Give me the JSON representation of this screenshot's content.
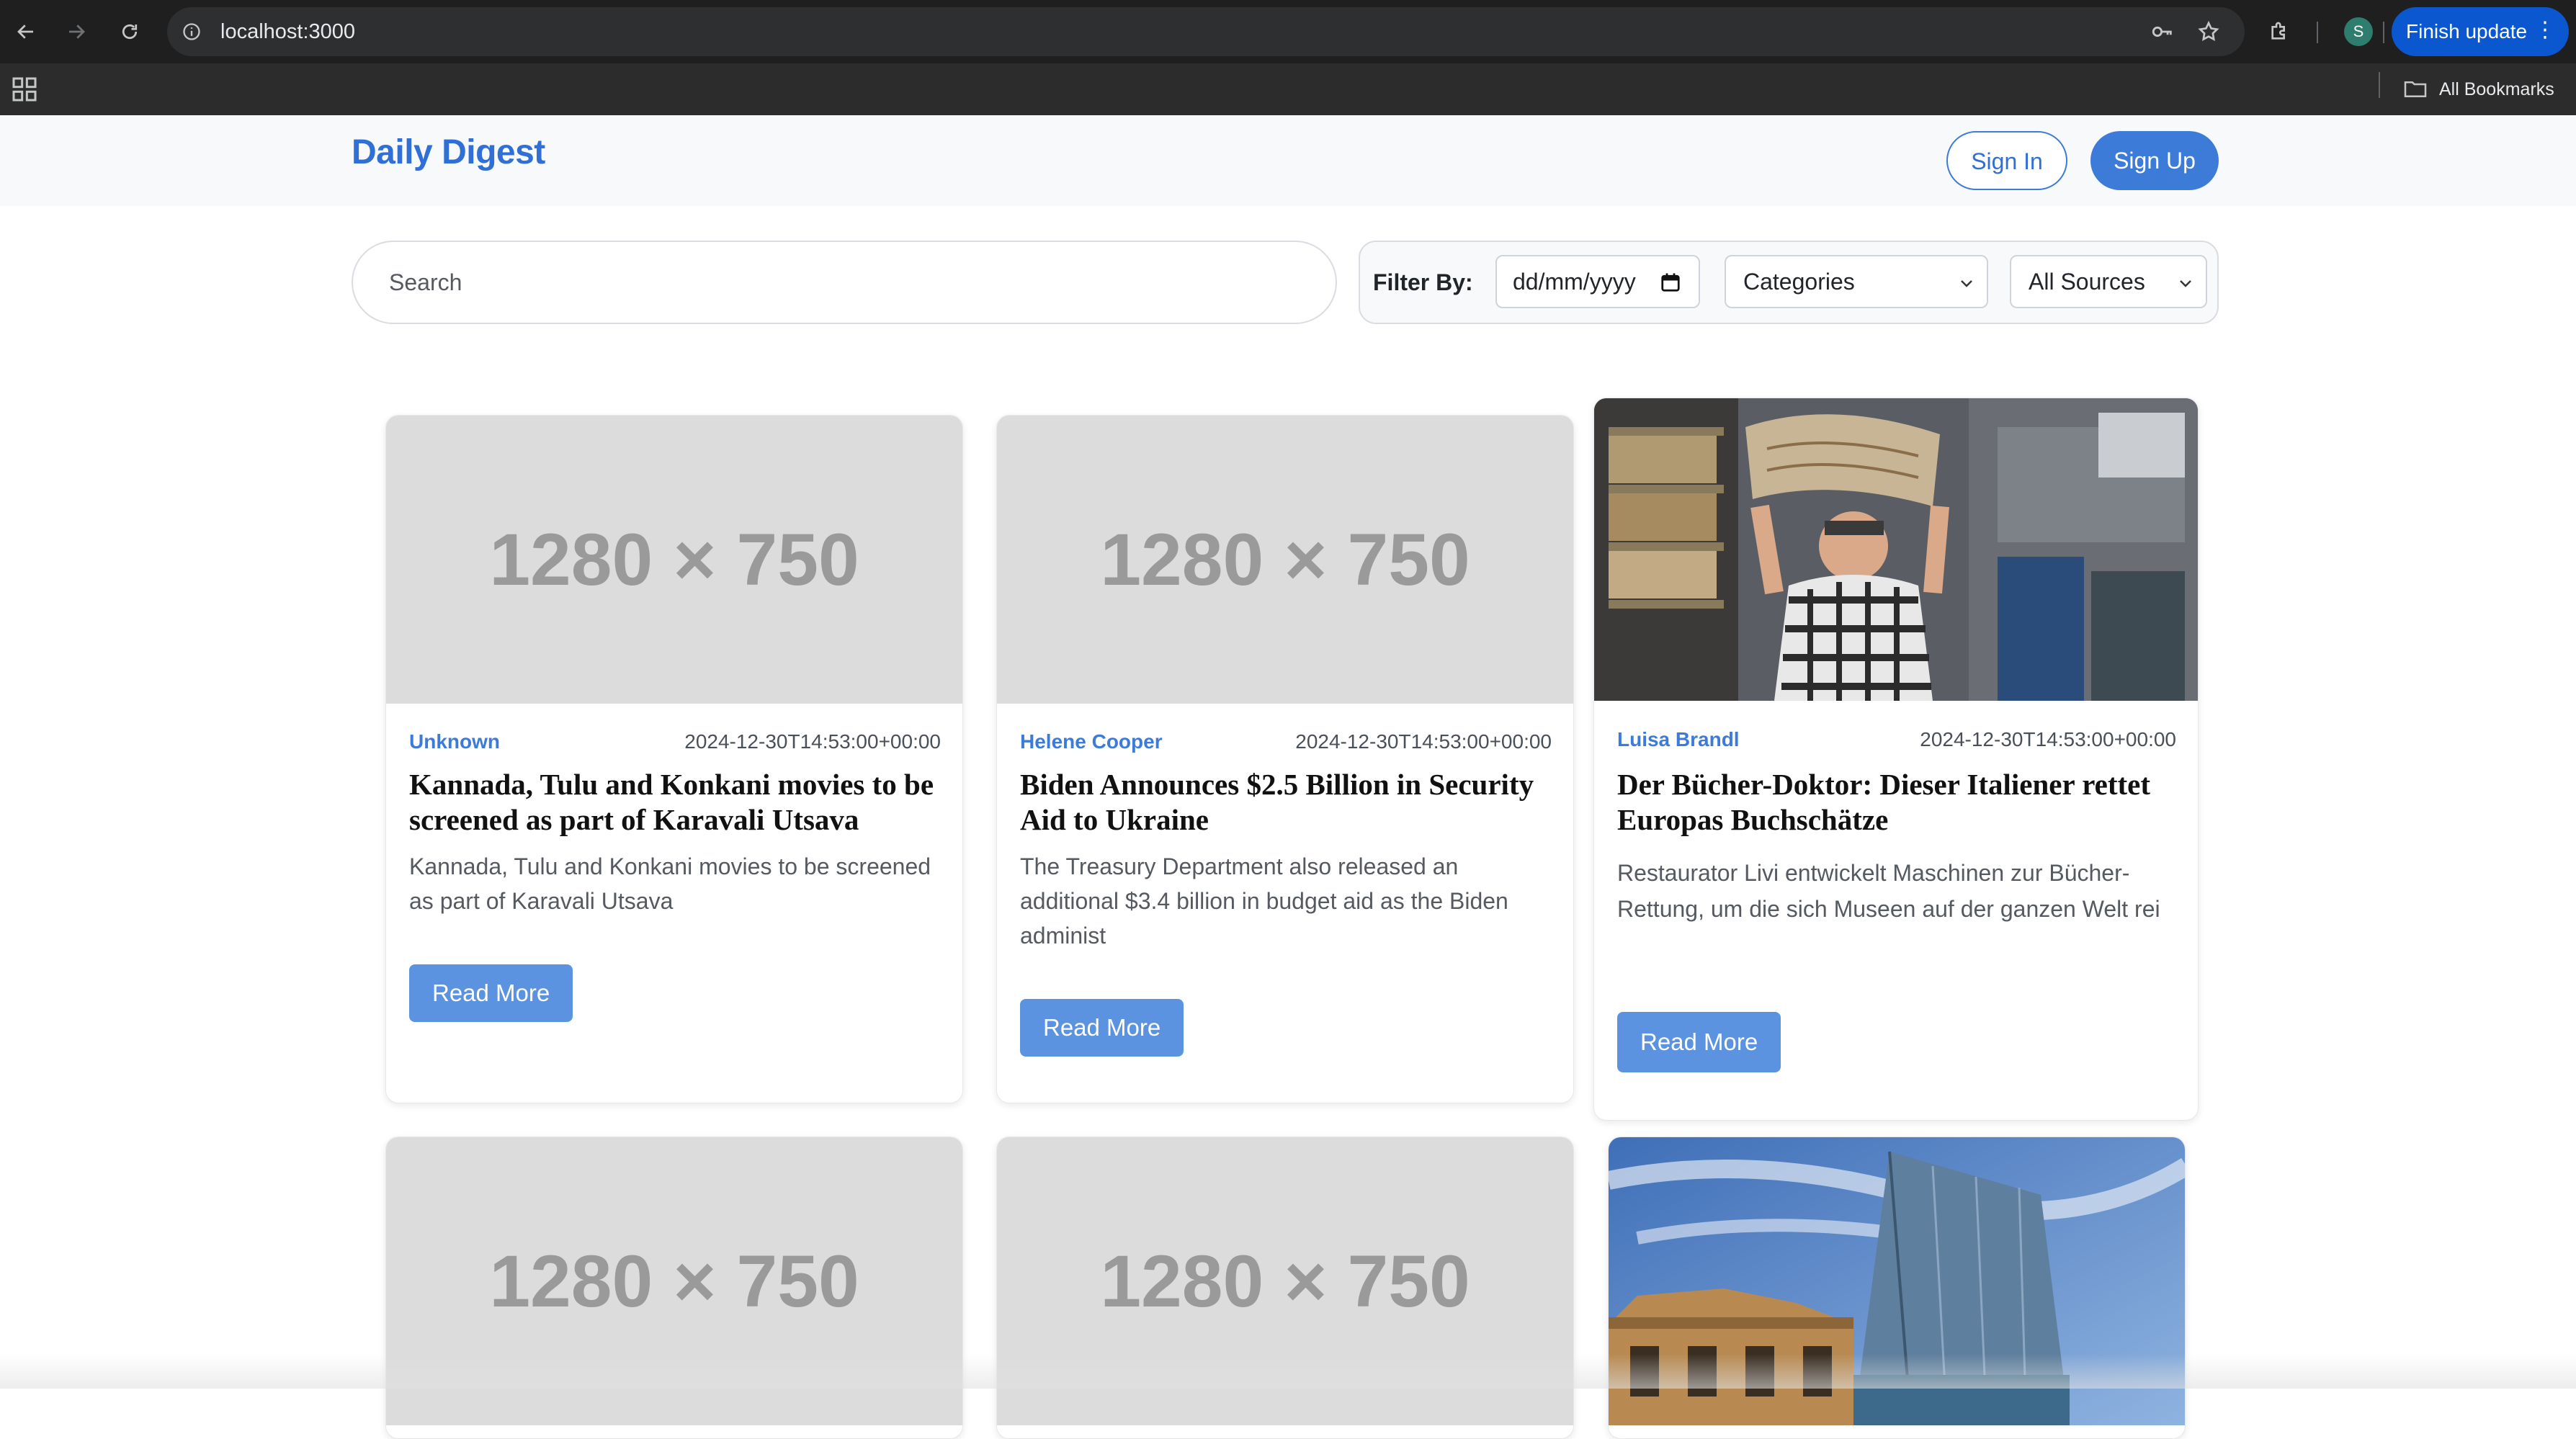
{
  "browser": {
    "url": "localhost:3000",
    "profile_initial": "S",
    "update_label": "Finish update",
    "bookmarks_label": "All Bookmarks"
  },
  "header": {
    "brand": "Daily Digest",
    "signin_label": "Sign In",
    "signup_label": "Sign Up"
  },
  "search": {
    "placeholder": "Search"
  },
  "filters": {
    "label": "Filter By:",
    "date_placeholder": "dd/mm/yyyy",
    "category_selected": "Categories",
    "source_selected": "All Sources"
  },
  "read_more_label": "Read More",
  "articles": [
    {
      "image_text": "1280 × 750",
      "author": "Unknown",
      "date": "2024-12-30T14:53:00+00:00",
      "title": "Kannada, Tulu and Konkani movies to be screened as part of Karavali Utsava",
      "description": "Kannada, Tulu and Konkani movies to be screened as part of Karavali Utsava"
    },
    {
      "image_text": "1280 × 750",
      "author": "Helene Cooper",
      "date": "2024-12-30T14:53:00+00:00",
      "title": "Biden Announces $2.5 Billion in Security Aid to Ukraine",
      "description": "The Treasury Department also released an additional $3.4 billion in budget aid as the Biden administ"
    },
    {
      "author": "Luisa Brandl",
      "date": "2024-12-30T14:53:00+00:00",
      "title": "Der Bücher-Doktor: Dieser Italiener rettet Europas Buchschätze",
      "description": "Restaurator Livi entwickelt Maschinen zur Bücher-Rettung, um die sich Museen auf der ganzen Welt rei"
    },
    {
      "image_text": "1280 × 750"
    },
    {
      "image_text": "1280 × 750"
    }
  ]
}
